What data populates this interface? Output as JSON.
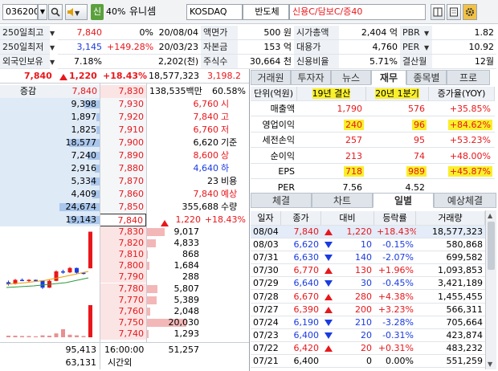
{
  "toolbar": {
    "code": "036200",
    "search_icon": "search-icon",
    "speaker_icon": "speaker-icon",
    "credit_badge": "신",
    "margin_rate": "40%",
    "stock_name": "유니셈",
    "market": "KOSDAQ",
    "sector": "반도체",
    "credit_info": "신용C/담보C/증40"
  },
  "info": {
    "rows": [
      {
        "l1": "250일최고",
        "v1": "7,840",
        "p1": "0%",
        "d1": "20/08/04",
        "l2": "액면가",
        "v2": "500 원",
        "l3": "시가총액",
        "v3": "2,404 억",
        "l4": "PBR",
        "v4": "1.82"
      },
      {
        "l1": "250일최저",
        "v1": "3,145",
        "p1": "+149.28%",
        "d1": "20/03/23",
        "l2": "자본금",
        "v2": "153 억",
        "l3": "대용가",
        "v3": "4,760",
        "l4": "PER",
        "v4": "10.92"
      },
      {
        "l1": "외국인보유",
        "v1": "7.18%",
        "p1": "",
        "d1": "2,202(천)",
        "l2": "주식수",
        "v2": "30,664 천",
        "l3": "신용비율",
        "v3": "5.71%",
        "l4": "결산월",
        "v4": "12월"
      }
    ]
  },
  "quote": {
    "price": "7,840",
    "change": "1,220",
    "rate": "+18.43%",
    "volume": "18,577,323",
    "prev_vol": "3,198.2",
    "hdr_change": "증감",
    "hdr_ask_top": "7,840",
    "hdr_ask_price": "7,830",
    "hdr_amount": "138,535백만",
    "hdr_ratio": "60.58%"
  },
  "orderbook": {
    "asks": [
      {
        "qty": "9,398",
        "price": "7,930"
      },
      {
        "qty": "1,897",
        "price": "7,920"
      },
      {
        "qty": "1,825",
        "price": "7,910"
      },
      {
        "qty": "18,577",
        "price": "7,900"
      },
      {
        "qty": "7,240",
        "price": "7,890"
      },
      {
        "qty": "2,916",
        "price": "7,880"
      },
      {
        "qty": "5,334",
        "price": "7,870"
      },
      {
        "qty": "4,409",
        "price": "7,860"
      },
      {
        "qty": "24,674",
        "price": "7,850"
      },
      {
        "qty": "19,143",
        "price": "7,840"
      }
    ],
    "bids": [
      {
        "price": "7,830",
        "qty": "9,017"
      },
      {
        "price": "7,820",
        "qty": "4,833"
      },
      {
        "price": "7,810",
        "qty": "868"
      },
      {
        "price": "7,800",
        "qty": "1,684"
      },
      {
        "price": "7,790",
        "qty": "288"
      },
      {
        "price": "7,780",
        "qty": "5,807"
      },
      {
        "price": "7,770",
        "qty": "5,389"
      },
      {
        "price": "7,760",
        "qty": "2,048"
      },
      {
        "price": "7,750",
        "qty": "20,030"
      },
      {
        "price": "7,740",
        "qty": "1,293"
      }
    ],
    "stats": [
      {
        "value": "6,760",
        "label": "시"
      },
      {
        "value": "7,840",
        "label": "고"
      },
      {
        "value": "6,760",
        "label": "저"
      },
      {
        "value": "6,620",
        "label": "기준"
      },
      {
        "value": "8,600",
        "label": "상"
      },
      {
        "value": "4,640",
        "label": "하"
      },
      {
        "value": "23",
        "label": "비용"
      },
      {
        "value": "7,840",
        "label": "예상"
      },
      {
        "value": "355,688",
        "label": "수량"
      }
    ],
    "expected_change": "1,220",
    "expected_rate": "+18.43%",
    "total_ask": "95,413",
    "time": "16:00:00",
    "total_bid": "51,257",
    "after_qty": "63,131",
    "after_label": "시간외"
  },
  "fin_tabs": [
    "거래원",
    "투자자",
    "뉴스",
    "재무",
    "종목별",
    "프로"
  ],
  "fin_active": 3,
  "fin": {
    "headers": [
      "단위(억원)",
      "19년 결산",
      "20년 1분기",
      "증가율(YOY)"
    ],
    "rows": [
      {
        "label": "매출액",
        "a": "1,790",
        "b": "576",
        "c": "+35.85%"
      },
      {
        "label": "영업이익",
        "a": "240",
        "b": "96",
        "c": "+84.62%"
      },
      {
        "label": "세전손익",
        "a": "257",
        "b": "95",
        "c": "+53.23%"
      },
      {
        "label": "순이익",
        "a": "213",
        "b": "74",
        "c": "+48.00%"
      },
      {
        "label": "EPS",
        "a": "718",
        "b": "989",
        "c": "+45.87%"
      },
      {
        "label": "PER",
        "a": "7.56",
        "b": "4.52",
        "c": ""
      }
    ]
  },
  "daily_tabs": [
    "체결",
    "차트",
    "일별",
    "예상체결"
  ],
  "daily_active": 2,
  "daily": {
    "headers": [
      "일자",
      "종가",
      "대비",
      "등락률",
      "거래량"
    ],
    "rows": [
      {
        "date": "08/04",
        "close": "7,840",
        "dir": "up",
        "diff": "1,220",
        "rate": "+18.43%",
        "vol": "18,577,323"
      },
      {
        "date": "08/03",
        "close": "6,620",
        "dir": "down",
        "diff": "10",
        "rate": "-0.15%",
        "vol": "580,868"
      },
      {
        "date": "07/31",
        "close": "6,630",
        "dir": "down",
        "diff": "140",
        "rate": "-2.07%",
        "vol": "699,582"
      },
      {
        "date": "07/30",
        "close": "6,770",
        "dir": "up",
        "diff": "130",
        "rate": "+1.96%",
        "vol": "1,093,853"
      },
      {
        "date": "07/29",
        "close": "6,640",
        "dir": "down",
        "diff": "30",
        "rate": "-0.45%",
        "vol": "3,421,189"
      },
      {
        "date": "07/28",
        "close": "6,670",
        "dir": "up",
        "diff": "280",
        "rate": "+4.38%",
        "vol": "1,455,455"
      },
      {
        "date": "07/27",
        "close": "6,390",
        "dir": "up",
        "diff": "200",
        "rate": "+3.23%",
        "vol": "566,311"
      },
      {
        "date": "07/24",
        "close": "6,190",
        "dir": "down",
        "diff": "210",
        "rate": "-3.28%",
        "vol": "705,664"
      },
      {
        "date": "07/23",
        "close": "6,400",
        "dir": "down",
        "diff": "20",
        "rate": "-0.31%",
        "vol": "423,874"
      },
      {
        "date": "07/22",
        "close": "6,420",
        "dir": "up",
        "diff": "20",
        "rate": "+0.31%",
        "vol": "483,232"
      },
      {
        "date": "07/21",
        "close": "6,400",
        "dir": "none",
        "diff": "0",
        "rate": "0.00%",
        "vol": "551,259"
      }
    ]
  },
  "mini_chart": {
    "candles": [
      {
        "o": 6350,
        "c": 6300,
        "h": 6400,
        "l": 6250
      },
      {
        "o": 6300,
        "c": 6420,
        "h": 6450,
        "l": 6280
      },
      {
        "o": 6420,
        "c": 6400,
        "h": 6460,
        "l": 6380
      },
      {
        "o": 6400,
        "c": 6420,
        "h": 6440,
        "l": 6360
      },
      {
        "o": 6420,
        "c": 6400,
        "h": 6430,
        "l": 6380
      },
      {
        "o": 6400,
        "c": 6190,
        "h": 6410,
        "l": 6150
      },
      {
        "o": 6190,
        "c": 6390,
        "h": 6420,
        "l": 6180
      },
      {
        "o": 6390,
        "c": 6670,
        "h": 6700,
        "l": 6380
      },
      {
        "o": 6670,
        "c": 6640,
        "h": 6720,
        "l": 6600
      },
      {
        "o": 6640,
        "c": 6770,
        "h": 6800,
        "l": 6620
      },
      {
        "o": 6770,
        "c": 6630,
        "h": 6780,
        "l": 6600
      },
      {
        "o": 6630,
        "c": 6620,
        "h": 6650,
        "l": 6580
      },
      {
        "o": 6760,
        "c": 7840,
        "h": 7840,
        "l": 6760
      }
    ],
    "volumes": [
      0.05,
      0.05,
      0.04,
      0.04,
      0.03,
      0.06,
      0.05,
      0.12,
      0.25,
      0.08,
      0.06,
      0.04,
      1.0
    ]
  }
}
